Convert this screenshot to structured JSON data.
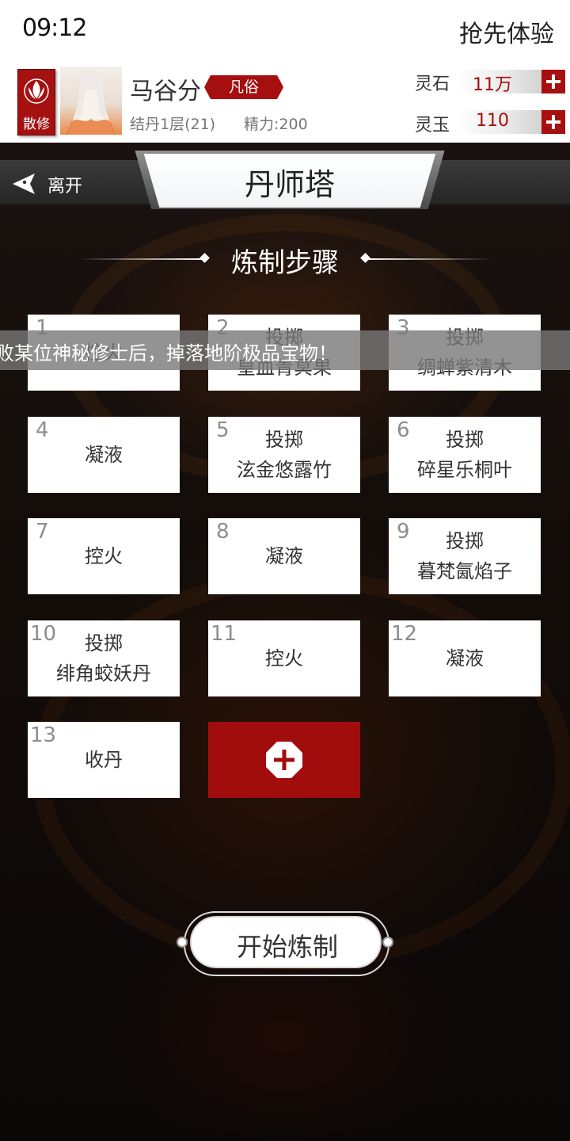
{
  "status_bar": {
    "time": "09:12",
    "early_access": "抢先体验"
  },
  "player": {
    "sect_badge": "散修",
    "name": "马谷分",
    "rank": "凡俗",
    "realm": "结丹1层(21)",
    "stamina": "精力:200"
  },
  "currencies": [
    {
      "label": "灵石",
      "value": "11万"
    },
    {
      "label": "灵玉",
      "value": "110"
    }
  ],
  "nav": {
    "back_label": "离开",
    "title": "丹师塔"
  },
  "section_title": "炼制步骤",
  "steps": [
    {
      "num": "1",
      "action": "控火",
      "item": ""
    },
    {
      "num": "2",
      "action": "投掷",
      "item": "皇血青冥果"
    },
    {
      "num": "3",
      "action": "投掷",
      "item": "绸蝉紫清木"
    },
    {
      "num": "4",
      "action": "凝液",
      "item": ""
    },
    {
      "num": "5",
      "action": "投掷",
      "item": "泫金悠露竹"
    },
    {
      "num": "6",
      "action": "投掷",
      "item": "碎星乐桐叶"
    },
    {
      "num": "7",
      "action": "控火",
      "item": ""
    },
    {
      "num": "8",
      "action": "凝液",
      "item": ""
    },
    {
      "num": "9",
      "action": "投掷",
      "item": "暮梵氤焰子"
    },
    {
      "num": "10",
      "action": "投掷",
      "item": "绯角蛟妖丹"
    },
    {
      "num": "11",
      "action": "控火",
      "item": ""
    },
    {
      "num": "12",
      "action": "凝液",
      "item": ""
    },
    {
      "num": "13",
      "action": "收丹",
      "item": ""
    }
  ],
  "banner": "败某位神秘修士后，掉落地阶极品宝物！",
  "start_button": "开始炼制",
  "colors": {
    "accent": "#a80f0f",
    "card": "#ffffff",
    "background": "#0a0707"
  }
}
